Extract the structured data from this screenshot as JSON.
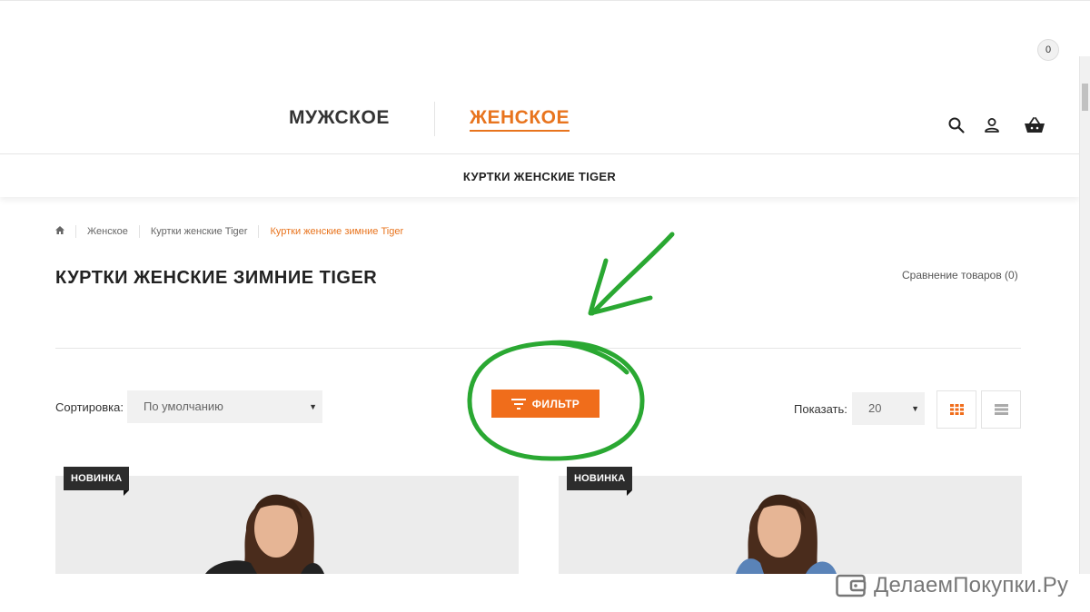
{
  "header": {
    "men_label": "МУЖСКОЕ",
    "women_label": "ЖЕНСКОЕ",
    "cart_count": "0"
  },
  "subnav": {
    "item": "КУРТКИ ЖЕНСКИЕ TIGER"
  },
  "breadcrumb": {
    "items": [
      "Женское",
      "Куртки женские Tiger",
      "Куртки женские зимние Tiger"
    ]
  },
  "page": {
    "title": "КУРТКИ ЖЕНСКИЕ ЗИМНИЕ TIGER",
    "compare": "Сравнение товаров (0)"
  },
  "toolbar": {
    "sort_label": "Сортировка:",
    "sort_value": "По умолчанию",
    "filter_label": "ФИЛЬТР",
    "show_label": "Показать:",
    "limit_value": "20"
  },
  "products": [
    {
      "badge": "НОВИНКА"
    },
    {
      "badge": "НОВИНКА"
    }
  ],
  "watermark": "ДелаемПокупки.Ру",
  "colors": {
    "accent": "#e8741e",
    "filter_button": "#f06d1b",
    "annotation": "#2aa832"
  }
}
